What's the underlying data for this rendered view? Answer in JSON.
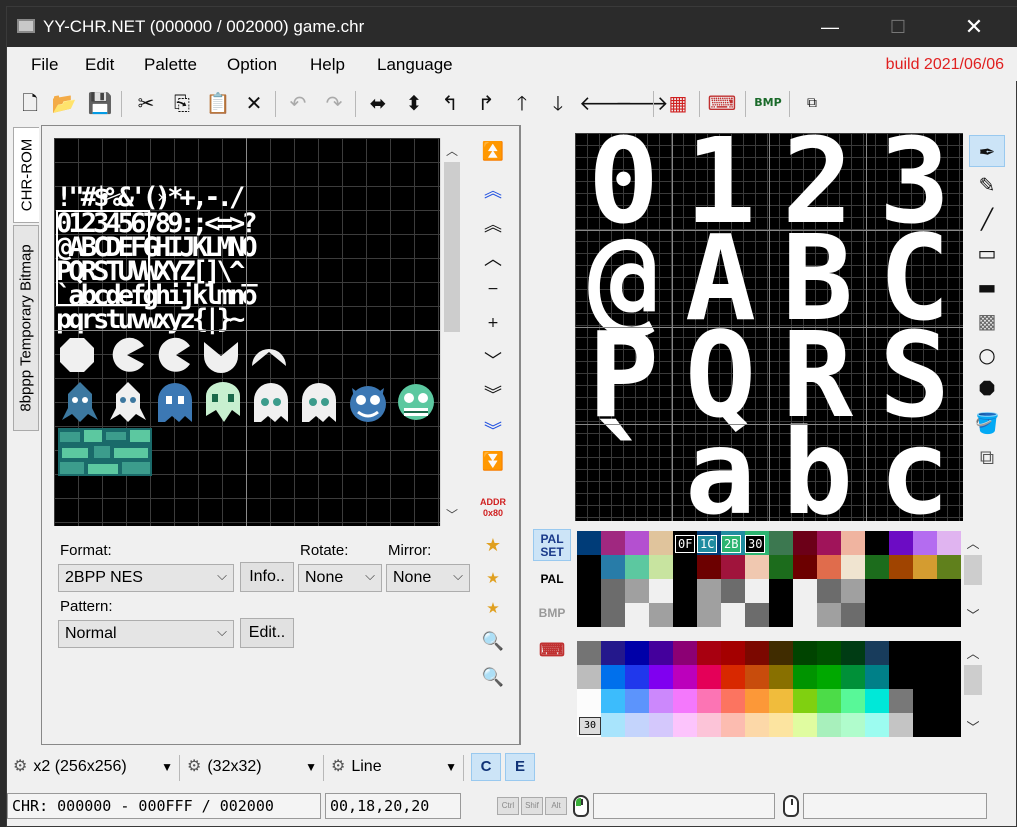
{
  "window": {
    "title": "YY-CHR.NET (000000 / 002000) game.chr",
    "minimize": "—",
    "maximize": "☐",
    "close": "✕"
  },
  "menu": {
    "items": [
      "File",
      "Edit",
      "Palette",
      "Option",
      "Help",
      "Language"
    ],
    "build": "build 2021/06/06"
  },
  "toolbar": {
    "icons": [
      "new-file-icon",
      "open-folder-icon",
      "save-icon",
      "cut-icon",
      "copy-icon",
      "paste-icon",
      "delete-icon",
      "undo-icon",
      "redo-icon",
      "flip-horizontal-icon",
      "flip-vertical-icon",
      "rotate-left-icon",
      "rotate-right-icon",
      "shift-up-icon",
      "shift-down-icon",
      "shift-left-icon",
      "shift-right-icon",
      "replace-color-icon",
      "property-icon",
      "bmp-icon",
      "popup-icon"
    ]
  },
  "side_tabs": [
    "CHR-ROM",
    "8bppp Temporary Bitmap"
  ],
  "chr_view": {
    "rows": [
      "  !\"#$%&'()*+,-./",
      "0123456789:;<=>?",
      "@ABCDEFGHIJKLMNO",
      "PQRSTUVWXYZ[]\\^_",
      "`abcdefghijklmno",
      "pqrstuvwxyz{|}~"
    ]
  },
  "format": {
    "format_label": "Format:",
    "format_value": "2BPP NES",
    "info_button": "Info..",
    "rotate_label": "Rotate:",
    "rotate_value": "None",
    "mirror_label": "Mirror:",
    "mirror_value": "None",
    "pattern_label": "Pattern:",
    "pattern_value": "Normal",
    "edit_button": "Edit.."
  },
  "nav": {
    "addr_label": "ADDR",
    "addr_value": "0x80"
  },
  "editor": {
    "chars": [
      "0",
      "1",
      "2",
      "3",
      "@",
      "A",
      "B",
      "C",
      "P",
      "Q",
      "R",
      "S",
      "`",
      "a",
      "b",
      "c"
    ]
  },
  "tools": [
    "pen-icon",
    "pencil-icon",
    "line-icon",
    "rectangle-icon",
    "filled-rectangle-icon",
    "pattern-fill-icon",
    "circle-icon",
    "filled-circle-icon",
    "paint-bucket-icon",
    "copy-area-icon"
  ],
  "palette_buttons": {
    "palset": "PAL SET",
    "pal": "PAL",
    "bmp": "BMP"
  },
  "palette_set": {
    "selected_codes": [
      "0F",
      "1C",
      "2B",
      "30"
    ],
    "rows": [
      [
        "#003c78",
        "#a02880",
        "#b450d0",
        "#e0c49c",
        "#000000",
        "#003c78",
        "#208ca0",
        "#2cb470",
        "#3c7850",
        "#6c0018",
        "#a0145a",
        "#f0b4a0",
        "#000000",
        "#6c0cc4",
        "#b46cf0",
        "#e0b4f0"
      ],
      [
        "#000000",
        "#287ca8",
        "#5cc8a0",
        "#c8e4a0",
        "#000000",
        "#6c0000",
        "#a0143c",
        "#f0c8b0",
        "#1c6c1c",
        "#6c0000",
        "#e06c4c",
        "#f0e4d0",
        "#1c6c1c",
        "#a04400",
        "#d49c30",
        "#60801c"
      ],
      [
        "#000000",
        "#6c6c6c",
        "#a0a0a0",
        "#f0f0f0",
        "#000000",
        "#a0a0a0",
        "#6c6c6c",
        "#f0f0f0",
        "#000000",
        "#f0f0f0",
        "#6c6c6c",
        "#a0a0a0",
        "#000000",
        "#000000",
        "#000000",
        "#000000"
      ],
      [
        "#000000",
        "#6c6c6c",
        "#f0f0f0",
        "#a0a0a0",
        "#000000",
        "#a0a0a0",
        "#f0f0f0",
        "#6c6c6c",
        "#000000",
        "#f0f0f0",
        "#a0a0a0",
        "#6c6c6c",
        "#000000",
        "#000000",
        "#000000",
        "#000000"
      ]
    ]
  },
  "nes_palette": {
    "rows": [
      [
        "#747474",
        "#24188c",
        "#0000a8",
        "#44009c",
        "#8c0074",
        "#a80010",
        "#a40000",
        "#7c0800",
        "#402c00",
        "#004400",
        "#005000",
        "#003c14",
        "#183c5c",
        "#000000",
        "#000000",
        "#000000"
      ],
      [
        "#bcbcbc",
        "#0070ec",
        "#2038ec",
        "#8000f0",
        "#bc00bc",
        "#e40058",
        "#d82800",
        "#c84c0c",
        "#887000",
        "#009400",
        "#00a800",
        "#009038",
        "#008088",
        "#000000",
        "#000000",
        "#000000"
      ],
      [
        "#fcfcfc",
        "#3cbcfc",
        "#5c94fc",
        "#cc88fc",
        "#f478fc",
        "#fc74b4",
        "#fc7460",
        "#fc9838",
        "#f0bc3c",
        "#80d010",
        "#4cdc48",
        "#58f898",
        "#00e8d8",
        "#787878",
        "#000000",
        "#000000"
      ],
      [
        "#fcfcfc",
        "#a8e4fc",
        "#c4d4fc",
        "#d4c8fc",
        "#fcc4fc",
        "#fcc4d8",
        "#fcbcb0",
        "#fcd8a8",
        "#fce4a0",
        "#e0fca0",
        "#a8f0bc",
        "#b0fccc",
        "#9cfcf0",
        "#c4c4c4",
        "#000000",
        "#000000"
      ]
    ],
    "badge": "30"
  },
  "bottom": {
    "zoom": "x2 (256x256)",
    "grid": "(32x32)",
    "draw_mode": "Line",
    "c_button": "C",
    "e_button": "E"
  },
  "status": {
    "chr_range": "CHR: 000000 - 000FFF / 002000",
    "coords": "00,18,20,20",
    "ctrl": "Ctrl",
    "shift": "Shif",
    "alt": "Alt"
  }
}
